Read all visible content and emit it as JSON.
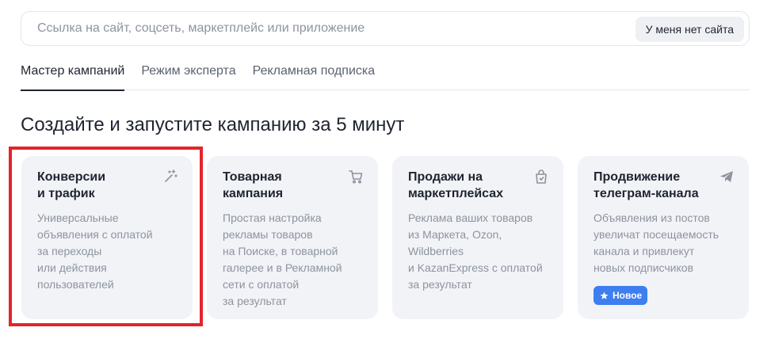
{
  "search": {
    "placeholder": "Ссылка на сайт, соцсеть, маркетплейс или приложение",
    "no_site_label": "У меня нет сайта"
  },
  "tabs": [
    {
      "label": "Мастер кампаний",
      "active": true
    },
    {
      "label": "Режим эксперта",
      "active": false
    },
    {
      "label": "Рекламная подписка",
      "active": false
    }
  ],
  "page_title": "Создайте и запустите кампанию за 5 минут",
  "cards": [
    {
      "title": "Конверсии\nи трафик",
      "description": "Универсальные\nобъявления с оплатой\nза переходы\nили действия\nпользователей",
      "icon": "magic-wand-icon",
      "highlighted": true
    },
    {
      "title": "Товарная\nкампания",
      "description": "Простая настройка\nрекламы товаров\nна Поиске, в товарной\nгалерее и в Рекламной\nсети с оплатой\nза результат",
      "icon": "shopping-cart-icon"
    },
    {
      "title": "Продажи на\nмаркетплейсах",
      "description": "Реклама ваших товаров\nиз Маркета, Ozon,\nWildberries\nи KazanExpress с оплатой\nза результат",
      "icon": "shopping-bag-icon"
    },
    {
      "title": "Продвижение\nтелеграм-канала",
      "description": "Объявления из постов\nувеличат посещаемость\nканала и привлекут\nновых подписчиков",
      "icon": "telegram-icon",
      "badge": "Новое"
    }
  ],
  "colors": {
    "highlight_border": "#e3242b",
    "card_background": "#f1f3f7",
    "badge_background": "#3d7ff0"
  }
}
